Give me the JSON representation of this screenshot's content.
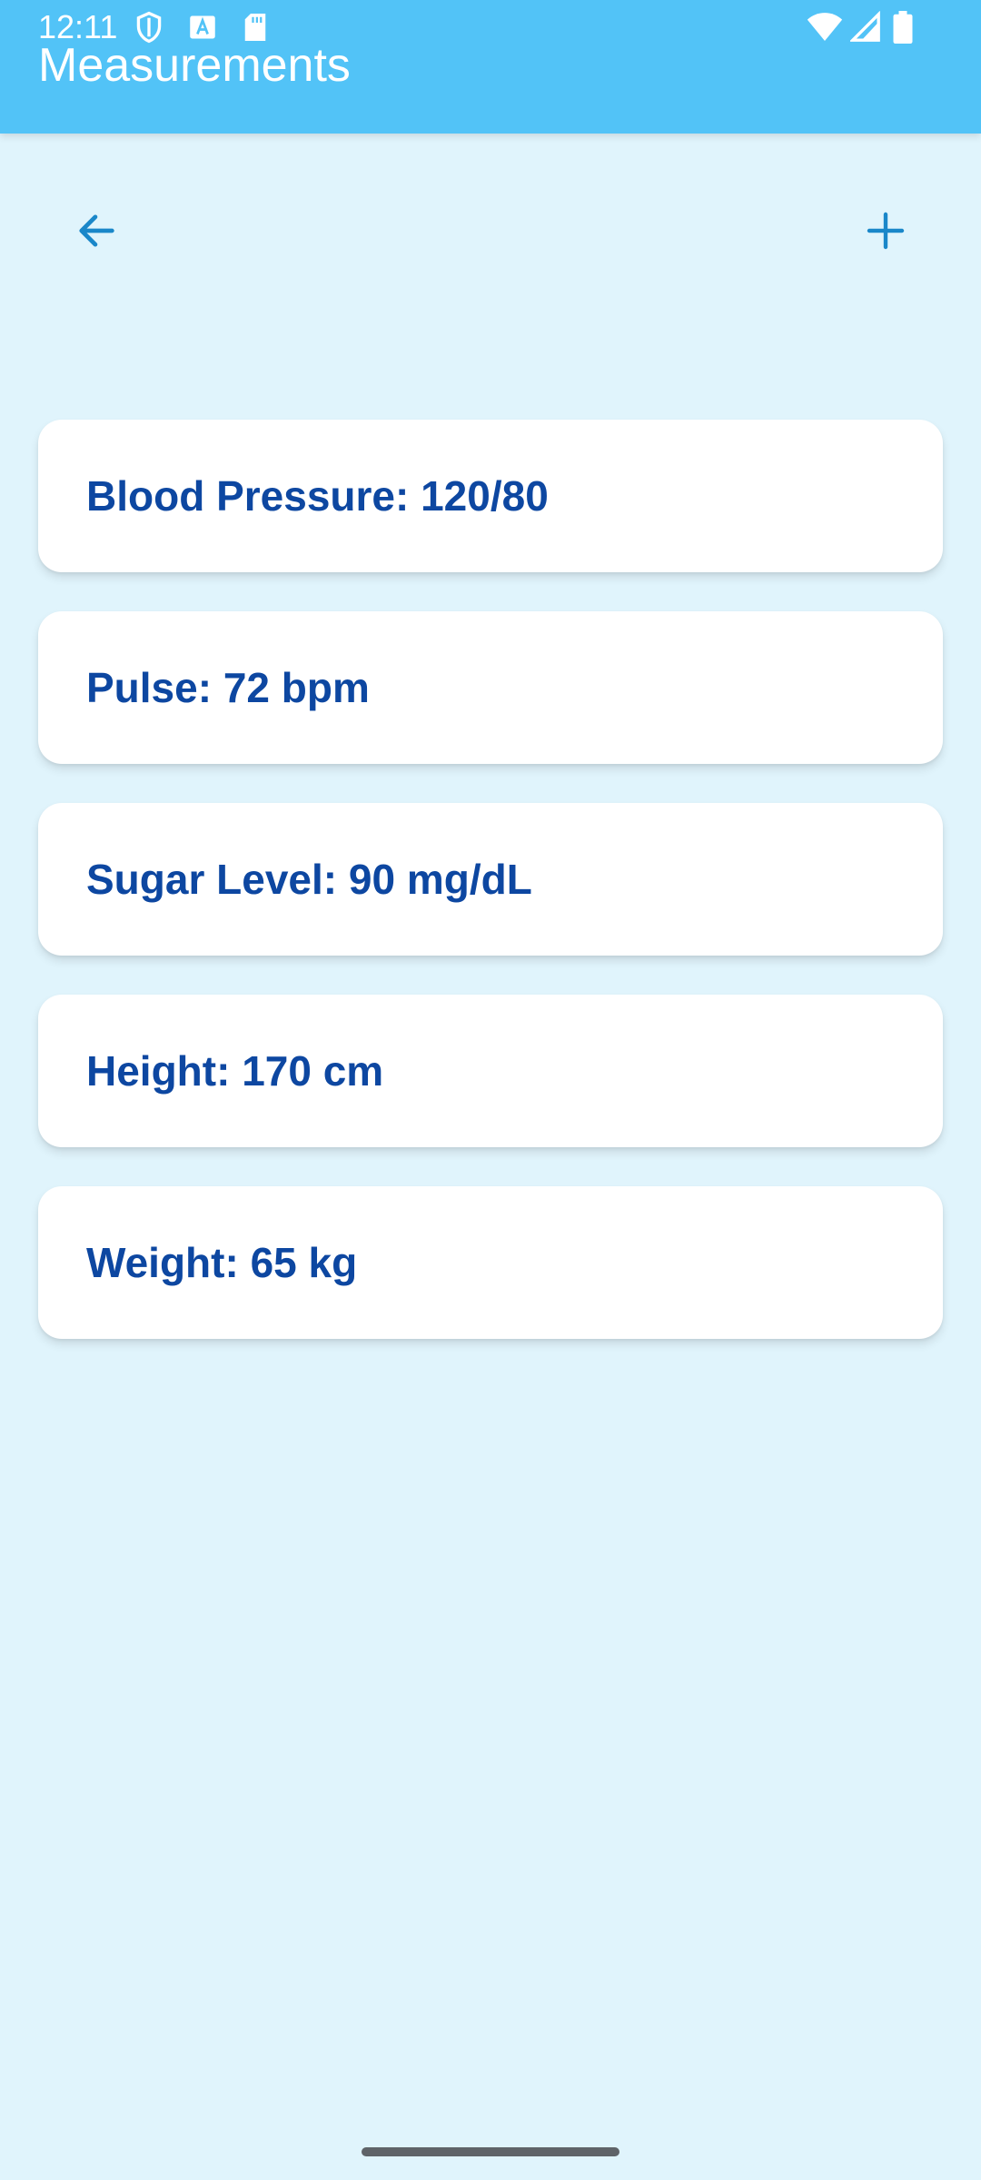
{
  "status_bar": {
    "time": "12:11",
    "left_icons": [
      "shield-icon",
      "text-a-icon",
      "sd-card-icon"
    ],
    "right_icons": [
      "wifi-icon",
      "cell-signal-icon",
      "battery-icon"
    ]
  },
  "app_bar": {
    "title": "Measurements",
    "background_color": "#52c3f7"
  },
  "toolbar": {
    "back_icon": "arrow-left-icon",
    "add_icon": "plus-icon",
    "icon_color": "#1a87c9"
  },
  "measurements": [
    {
      "label": "Blood Pressure: 120/80"
    },
    {
      "label": "Pulse: 72 bpm"
    },
    {
      "label": "Sugar Level: 90 mg/dL"
    },
    {
      "label": "Height: 170 cm"
    },
    {
      "label": "Weight: 65 kg"
    }
  ],
  "colors": {
    "page_background": "#e0f4fc",
    "card_text": "#0d47a1"
  }
}
